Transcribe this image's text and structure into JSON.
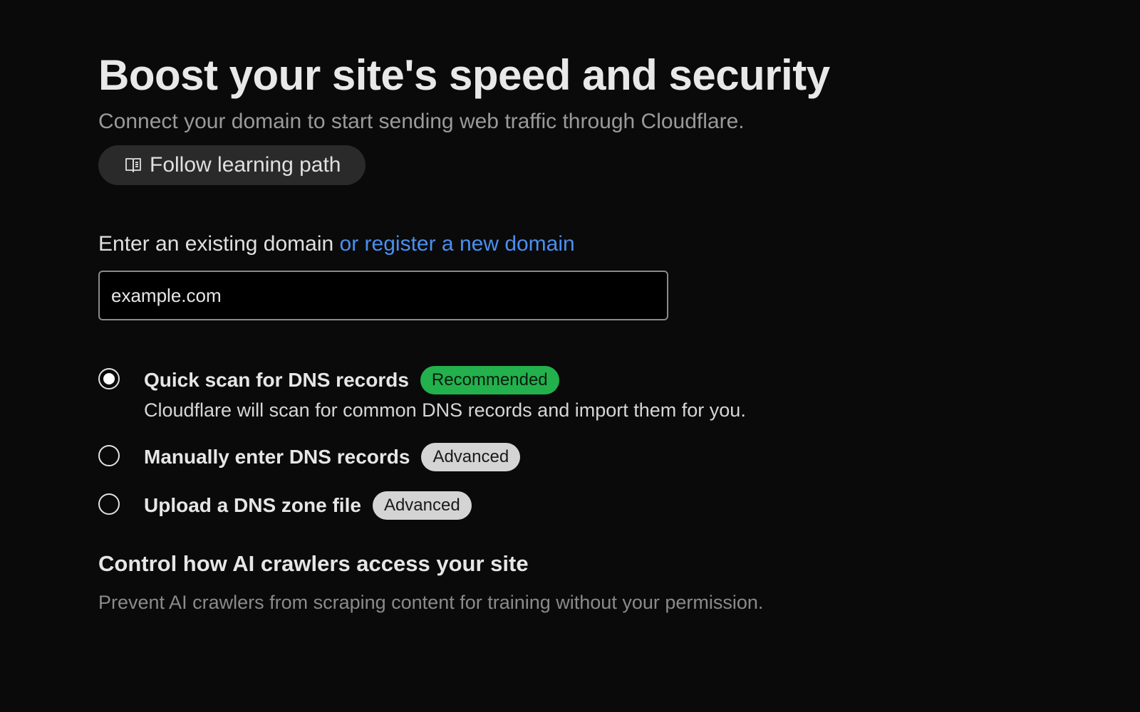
{
  "header": {
    "title": "Boost your site's speed and security",
    "subtitle": "Connect your domain to start sending web traffic through Cloudflare.",
    "learning_button": {
      "label": "Follow learning path",
      "icon": "book-icon"
    }
  },
  "domain": {
    "label_prefix": "Enter an existing domain",
    "register_link": "or register a new domain",
    "input_value": "",
    "input_placeholder": "example.com"
  },
  "dns_options": [
    {
      "title": "Quick scan for DNS records",
      "badge": "Recommended",
      "badge_color": "#22b14c",
      "description": "Cloudflare will scan for common DNS records and import them for you.",
      "selected": true
    },
    {
      "title": "Manually enter DNS records",
      "badge": "Advanced",
      "badge_color": "#d4d4d4",
      "selected": false
    },
    {
      "title": "Upload a DNS zone file",
      "badge": "Advanced",
      "badge_color": "#d4d4d4",
      "selected": false
    }
  ],
  "ai_crawlers": {
    "title": "Control how AI crawlers access your site",
    "description": "Prevent AI crawlers from scraping content for training without your permission."
  },
  "colors": {
    "background": "#0a0a0a",
    "link": "#4a8ff0",
    "recommended_badge": "#22b14c",
    "advanced_badge": "#d4d4d4"
  }
}
